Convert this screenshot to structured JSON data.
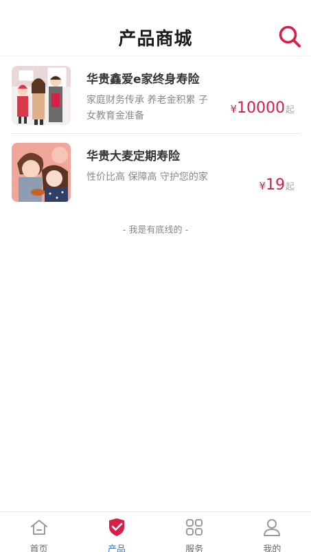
{
  "header": {
    "title": "产品商城"
  },
  "products": [
    {
      "name": "华贵鑫爱e家终身寿险",
      "desc": "家庭财务传承 养老金积累 子女教育金准备",
      "currency": "¥",
      "price": "10000",
      "suffix": "起"
    },
    {
      "name": "华贵大麦定期寿险",
      "desc": "性价比高 保障高 守护您的家",
      "currency": "¥",
      "price": "19",
      "suffix": "起"
    }
  ],
  "footer_note": "- 我是有底线的 -",
  "tabbar": {
    "items": [
      {
        "label": "首页",
        "icon": "home-icon",
        "active": false
      },
      {
        "label": "产品",
        "icon": "shield-check-icon",
        "active": true
      },
      {
        "label": "服务",
        "icon": "grid-icon",
        "active": false
      },
      {
        "label": "我的",
        "icon": "user-icon",
        "active": false
      }
    ]
  },
  "colors": {
    "accent_red": "#d81e46",
    "active_blue": "#2b6fd6"
  }
}
